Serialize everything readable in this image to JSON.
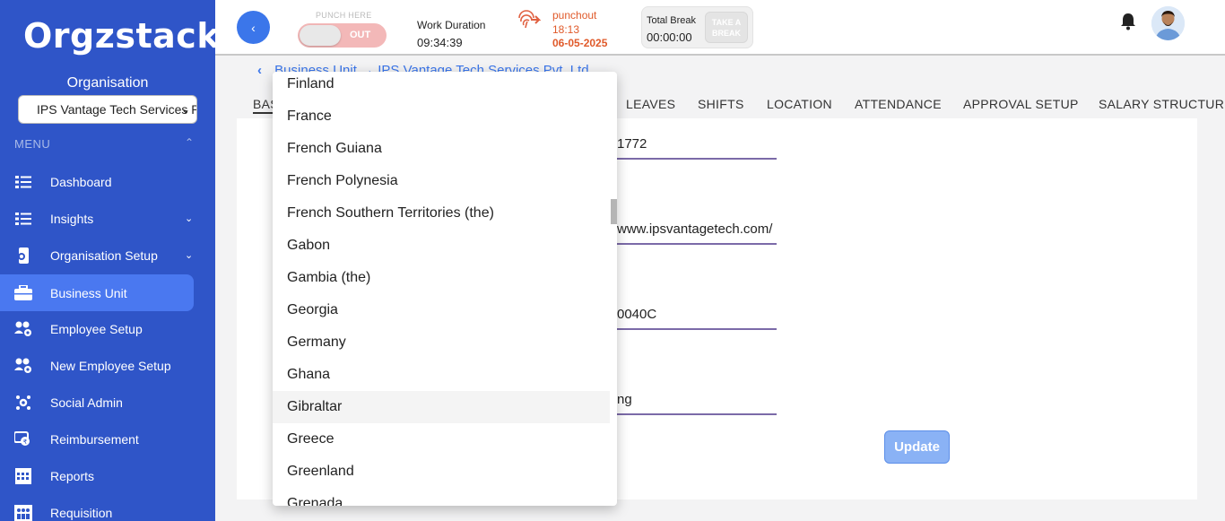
{
  "sidebar": {
    "logo": "Orgzstack",
    "org_label": "Organisation",
    "org_selected": "IPS Vantage Tech Services Pvt. Ltd",
    "menu_label": "MENU",
    "items": [
      {
        "label": "Dashboard",
        "icon": "list-icon",
        "chevron": false,
        "active": false
      },
      {
        "label": "Insights",
        "icon": "list-icon",
        "chevron": true,
        "active": false
      },
      {
        "label": "Organisation Setup",
        "icon": "phone-gear-icon",
        "chevron": true,
        "active": false
      },
      {
        "label": "Business Unit",
        "icon": "briefcase-icon",
        "chevron": false,
        "active": true
      },
      {
        "label": "Employee Setup",
        "icon": "users-gear-icon",
        "chevron": false,
        "active": false
      },
      {
        "label": "New Employee Setup",
        "icon": "users-gear-icon",
        "chevron": false,
        "active": false
      },
      {
        "label": "Social Admin",
        "icon": "joomla-icon",
        "chevron": false,
        "active": false
      },
      {
        "label": "Reimbursement",
        "icon": "money-hand-icon",
        "chevron": false,
        "active": false
      },
      {
        "label": "Reports",
        "icon": "calendar-grid-icon",
        "chevron": false,
        "active": false
      },
      {
        "label": "Requisition",
        "icon": "people-chart-icon",
        "chevron": false,
        "active": false
      }
    ]
  },
  "topbar": {
    "punch_label": "PUNCH HERE",
    "punch_state": "OUT",
    "work_duration_label": "Work Duration",
    "work_duration_value": "09:34:39",
    "punchout_label": "punchout",
    "punchout_time": "18:13",
    "punchout_date": "06-05-2025",
    "total_break_label": "Total Break",
    "total_break_value": "00:00:00",
    "take_break_label": "TAKE A BREAK"
  },
  "breadcrumb": {
    "root": "Business Unit",
    "current": "IPS Vantage Tech Services Pvt. Ltd"
  },
  "tabs": [
    "BASIC DETAILS",
    "LEAVES",
    "SHIFTS",
    "LOCATION",
    "ATTENDANCE",
    "APPROVAL SETUP",
    "SALARY STRUCTURE"
  ],
  "fields": [
    {
      "value": "1772"
    },
    {
      "value": "www.ipsvantagetech.com/"
    },
    {
      "value": "0040C"
    },
    {
      "value": "ng"
    }
  ],
  "update_label": "Update",
  "dropdown": {
    "options": [
      "Finland",
      "France",
      "French Guiana",
      "French Polynesia",
      "French Southern Territories (the)",
      "Gabon",
      "Gambia (the)",
      "Georgia",
      "Germany",
      "Ghana",
      "Gibraltar",
      "Greece",
      "Greenland",
      "Grenada"
    ],
    "hover_index": 10
  },
  "colors": {
    "sidebar_bg": "#2f55c8",
    "active_item": "#4a78f0",
    "accent": "#3b76ea",
    "punchout": "#e05a2a",
    "field_underline": "#7b6aa8"
  }
}
